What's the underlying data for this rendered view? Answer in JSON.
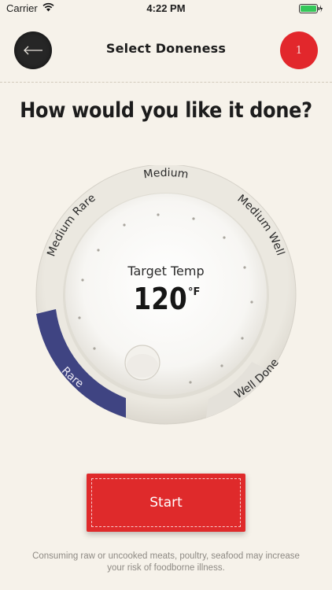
{
  "status_bar": {
    "carrier": "Carrier",
    "time": "4:22 PM",
    "icons": [
      "wifi-icon",
      "battery-icon",
      "charging-icon"
    ],
    "battery_color": "#34c759"
  },
  "nav": {
    "title": "Select Doneness",
    "back_icon": "arrow-left-icon",
    "badge_count": "1",
    "badge_color": "#e2272c"
  },
  "question": "How would you like it done?",
  "dial": {
    "labels": {
      "rare": "Rare",
      "medium_rare": "Medium Rare",
      "medium": "Medium",
      "medium_well": "Medium Well",
      "well_done": "Well Done"
    },
    "selected": "Rare",
    "selected_color": "#3f4482",
    "target_label": "Target Temp",
    "target_value": "120",
    "target_unit": "°F"
  },
  "start_button": {
    "label": "Start",
    "color": "#df2a2b"
  },
  "disclaimer": "Consuming raw or uncooked meats, poultry, seafood may increase your risk of foodborne illness."
}
